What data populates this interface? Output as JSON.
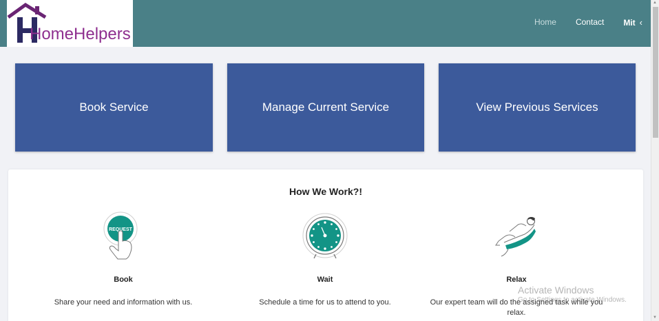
{
  "brand": {
    "logo_text": "HomeHelpers",
    "logo_color": "#8e2f8f",
    "roof_color": "#6a2574"
  },
  "nav": {
    "home": "Home",
    "contact": "Contact",
    "user": "Mit",
    "user_chevron": "‹"
  },
  "cards": [
    {
      "label": "Book Service"
    },
    {
      "label": "Manage Current Service"
    },
    {
      "label": "View Previous Services"
    }
  ],
  "how": {
    "title": "How We Work?!",
    "steps": [
      {
        "name": "Book",
        "desc": "Share your need and information with us.",
        "icon": "request-button-icon",
        "icon_text": "REQUEST"
      },
      {
        "name": "Wait",
        "desc": "Schedule a time for us to attend to you.",
        "icon": "clock-icon"
      },
      {
        "name": "Relax",
        "desc": "Our expert team will do the assigned task while you relax.",
        "icon": "relaxing-person-icon"
      }
    ]
  },
  "watermark": {
    "title": "Activate Windows",
    "subtitle": "Go to Settings to activate Windows."
  },
  "colors": {
    "navbar": "#4a8087",
    "card": "#3c5a9b",
    "teal_accent": "#139486"
  }
}
